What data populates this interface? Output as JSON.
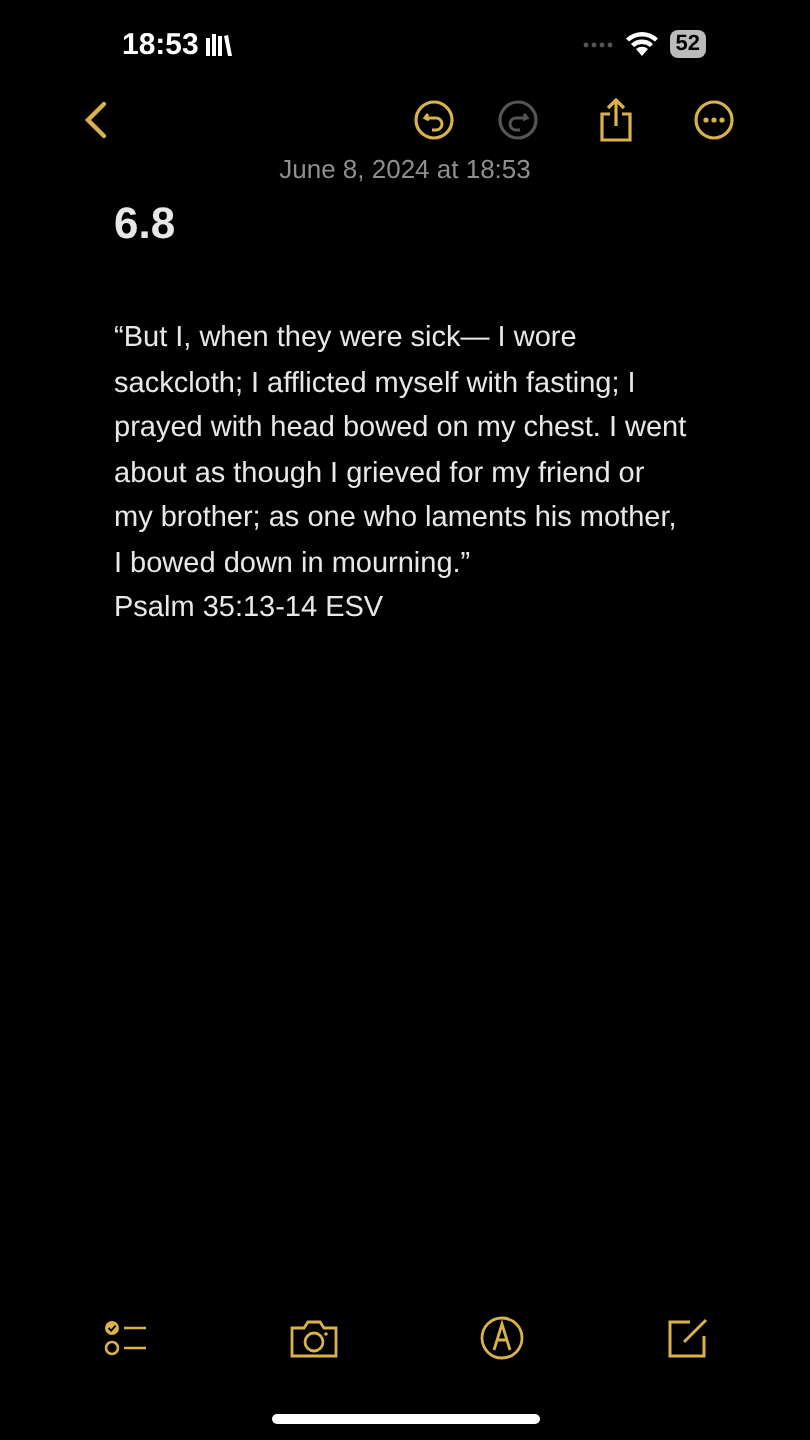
{
  "status_bar": {
    "time": "18:53",
    "battery": "52"
  },
  "toolbar": {
    "undo": {
      "disabled": false
    },
    "redo": {
      "disabled": true
    }
  },
  "note": {
    "date": "June 8, 2024 at 18:53",
    "title": "6.8",
    "body_lines": [
      "“But I, when they were sick— I wore",
      "sackcloth; I afflicted myself with fasting; I",
      "prayed with head bowed on my chest. I went",
      "about as though I grieved for my friend or",
      "my brother; as one who laments his mother,",
      "I bowed down in mourning.”"
    ],
    "reference": "Psalm 35:13-14 ESV"
  }
}
